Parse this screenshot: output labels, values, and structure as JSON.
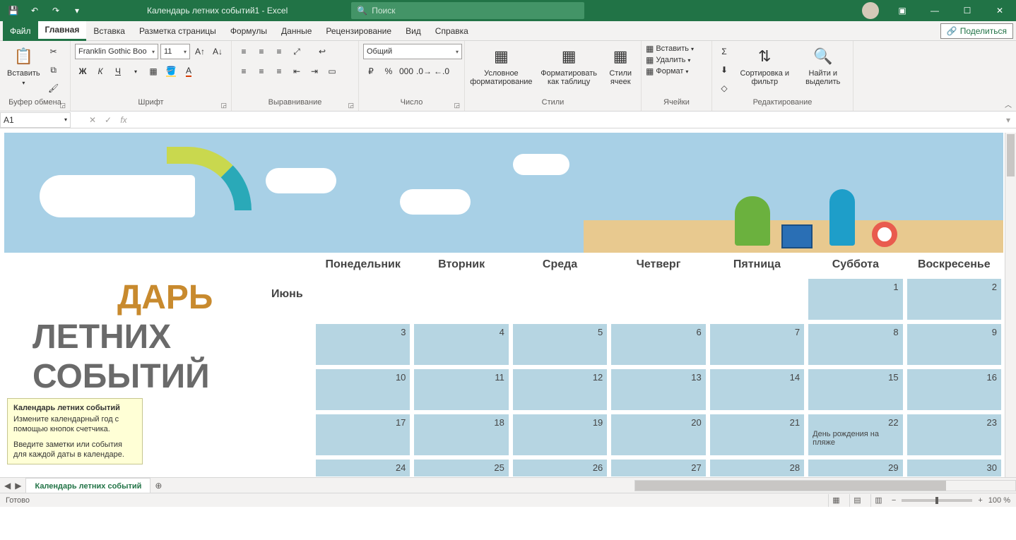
{
  "titlebar": {
    "doc_title": "Календарь летних событий1 - Excel",
    "search_placeholder": "Поиск"
  },
  "tabs": {
    "file": "Файл",
    "home": "Главная",
    "insert": "Вставка",
    "layout": "Разметка страницы",
    "formulas": "Формулы",
    "data": "Данные",
    "review": "Рецензирование",
    "view": "Вид",
    "help": "Справка",
    "share": "Поделиться"
  },
  "ribbon": {
    "clipboard": {
      "label": "Буфер обмена",
      "paste": "Вставить"
    },
    "font": {
      "label": "Шрифт",
      "name": "Franklin Gothic Boo",
      "size": "11",
      "bold": "Ж",
      "italic": "К",
      "underline": "Ч"
    },
    "alignment": {
      "label": "Выравнивание"
    },
    "number": {
      "label": "Число",
      "format": "Общий"
    },
    "styles": {
      "label": "Стили",
      "cond": "Условное форматирование",
      "table": "Форматировать как таблицу",
      "cells_styles": "Стили ячеек"
    },
    "cells": {
      "label": "Ячейки",
      "insert": "Вставить",
      "delete": "Удалить",
      "format": "Формат"
    },
    "editing": {
      "label": "Редактирование",
      "sort": "Сортировка и фильтр",
      "find": "Найти и выделить"
    }
  },
  "formula_bar": {
    "cell_ref": "A1",
    "formula": ""
  },
  "tooltip": {
    "title": "Календарь летних событий",
    "line1": "Измените календарный год с помощью кнопок счетчика.",
    "line2": "Введите заметки или события для каждой даты в календаре."
  },
  "calendar": {
    "title_part1": "ДАРЬ",
    "title_line2": "ЛЕТНИХ",
    "title_line3": "СОБЫТИЙ",
    "month": "Июнь",
    "days": [
      "Понедельник",
      "Вторник",
      "Среда",
      "Четверг",
      "Пятница",
      "Суббота",
      "Воскресенье"
    ],
    "grid": [
      [
        "",
        "",
        "",
        "",
        "",
        "1",
        "2"
      ],
      [
        "3",
        "4",
        "5",
        "6",
        "7",
        "8",
        "9"
      ],
      [
        "10",
        "11",
        "12",
        "13",
        "14",
        "15",
        "16"
      ],
      [
        "17",
        "18",
        "19",
        "20",
        "21",
        "22",
        "23"
      ],
      [
        "24",
        "25",
        "26",
        "27",
        "28",
        "29",
        "30"
      ]
    ],
    "event_22": "День рождения на пляже"
  },
  "sheet_tab": "Календарь летних событий",
  "status": {
    "ready": "Готово",
    "zoom": "100 %"
  }
}
